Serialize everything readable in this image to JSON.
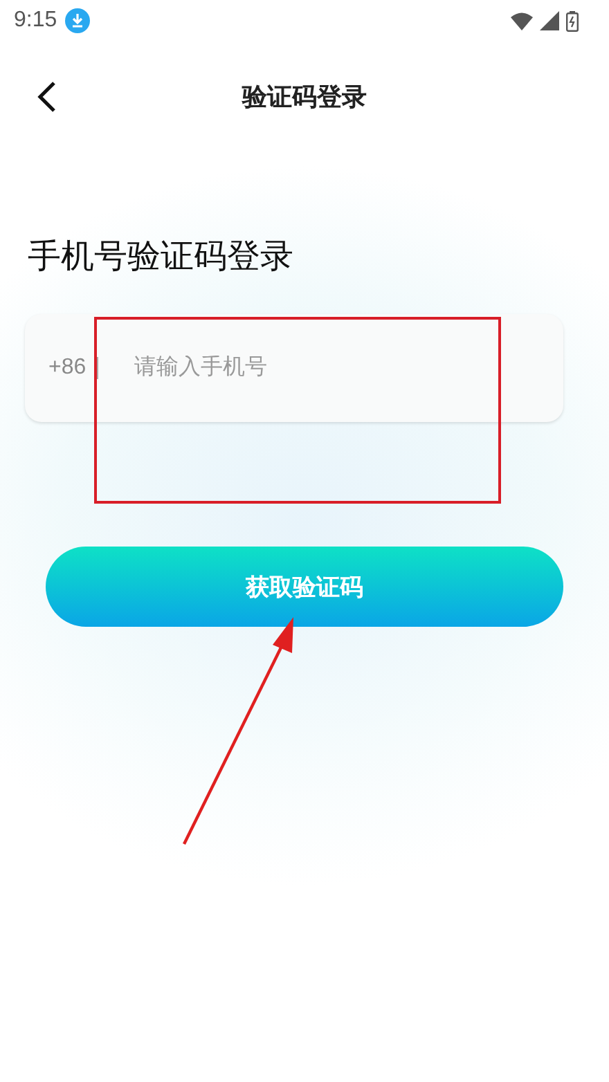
{
  "status_bar": {
    "time": "9:15"
  },
  "header": {
    "title": "验证码登录"
  },
  "heading": "手机号验证码登录",
  "phone_field": {
    "prefix": "+86",
    "placeholder": "请输入手机号"
  },
  "submit_button": {
    "label": "获取验证码"
  }
}
